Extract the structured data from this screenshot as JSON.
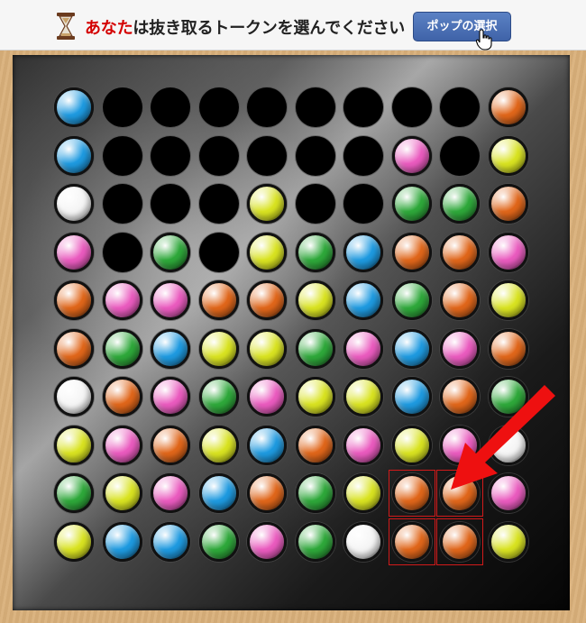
{
  "header": {
    "prompt_highlight": "あなた",
    "prompt_rest": "は抜き取るトークンを選んでください",
    "pop_button_label": "ポップの選択"
  },
  "colors": {
    "blue": "#1e9ae0",
    "orange": "#e0661a",
    "pink": "#ea5bbf",
    "yellow": "#d9e321",
    "green": "#2ea83a",
    "white": "#f5f5f5",
    "selection": "#d21a1a",
    "arrow": "#ee1010"
  },
  "board": {
    "rows": 10,
    "cols": 10,
    "grid": [
      [
        "B",
        "E",
        "E",
        "E",
        "E",
        "E",
        "E",
        "E",
        "E",
        "O"
      ],
      [
        "B",
        "E",
        "E",
        "E",
        "E",
        "E",
        "E",
        "P",
        "E",
        "Y"
      ],
      [
        "W",
        "E",
        "E",
        "E",
        "Y",
        "E",
        "E",
        "G",
        "G",
        "O"
      ],
      [
        "P",
        "E",
        "G",
        "E",
        "Y",
        "G",
        "B",
        "O",
        "O",
        "P"
      ],
      [
        "O",
        "P",
        "P",
        "O",
        "O",
        "Y",
        "B",
        "G",
        "O",
        "Y"
      ],
      [
        "O",
        "G",
        "B",
        "Y",
        "Y",
        "G",
        "P",
        "B",
        "P",
        "O"
      ],
      [
        "W",
        "O",
        "P",
        "G",
        "P",
        "Y",
        "Y",
        "B",
        "O",
        "G"
      ],
      [
        "Y",
        "P",
        "O",
        "Y",
        "B",
        "O",
        "P",
        "Y",
        "P",
        "W"
      ],
      [
        "G",
        "Y",
        "P",
        "B",
        "O",
        "G",
        "Y",
        "O",
        "O",
        "P"
      ],
      [
        "Y",
        "B",
        "B",
        "G",
        "P",
        "G",
        "W",
        "O",
        "O",
        "Y"
      ]
    ],
    "selected": [
      [
        8,
        7
      ],
      [
        8,
        8
      ],
      [
        9,
        7
      ],
      [
        9,
        8
      ]
    ]
  }
}
